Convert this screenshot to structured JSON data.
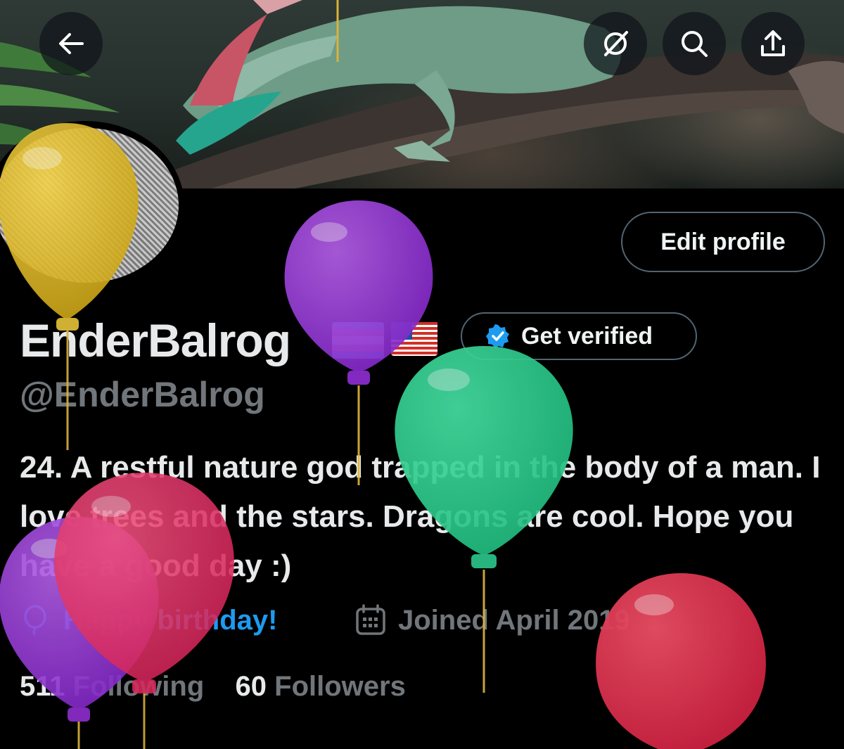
{
  "header": {
    "buttons": [
      {
        "icon": "back-arrow-icon"
      },
      {
        "icon": "grok-icon"
      },
      {
        "icon": "search-icon"
      },
      {
        "icon": "share-icon"
      }
    ]
  },
  "profile": {
    "display_name": "EnderBalrog",
    "flags": [
      "trans-pride-flag",
      "us-flag"
    ],
    "handle": "@EnderBalrog",
    "bio": "24. A restful nature god trapped in the body of a man. I love trees and the stars. Dragons are cool. Hope you have a good day :)",
    "birthday_text": "Happy birthday!",
    "joined_text": "Joined April 2019",
    "following_count": "511",
    "following_label": "Following",
    "followers_count": "60",
    "followers_label": "Followers"
  },
  "actions": {
    "edit_profile_label": "Edit profile",
    "get_verified_label": "Get verified"
  },
  "colors": {
    "accent": "#1d9bf0",
    "muted_text": "#71767b",
    "primary_text": "#e7e9ea",
    "background": "#000000",
    "balloon_yellow": "#e8c020",
    "balloon_purple": "#9b3fd6",
    "balloon_green": "#2bd08e",
    "balloon_pink": "#e8386a",
    "balloon_red": "#e0304e"
  }
}
